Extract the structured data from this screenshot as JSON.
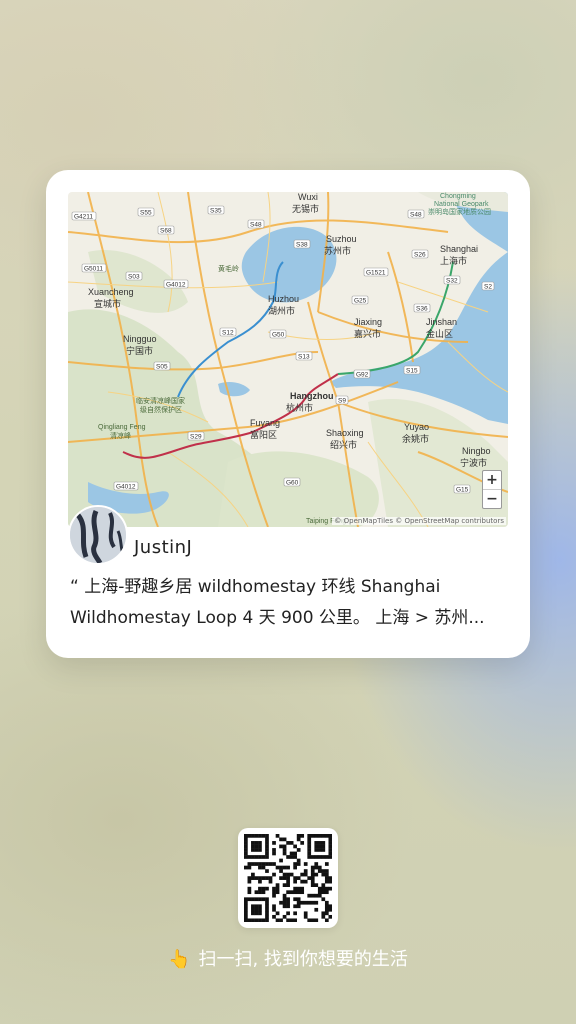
{
  "card": {
    "author": "JustinJ",
    "quote_line1": "“ 上海-野趣乡居 wildhomestay 环线 Shanghai",
    "quote_line2": "Wildhomestay Loop 4 天 900 公里。 上海 > 苏州..."
  },
  "map": {
    "zoom_in": "+",
    "zoom_out": "−",
    "attribution": "© OpenMapTiles © OpenStreetMap contributors",
    "labels": {
      "wuxi": "Wuxi",
      "wuxi_cn": "无锡市",
      "suzhou": "Suzhou",
      "suzhou_cn": "苏州市",
      "shanghai": "Shanghai",
      "shanghai_cn": "上海市",
      "huzhou": "Huzhou",
      "huzhou_cn": "湖州市",
      "jiaxing": "Jiaxing",
      "jiaxing_cn": "嘉兴市",
      "jinshan": "Jinshan",
      "jinshan_cn": "金山区",
      "xuancheng": "Xuancheng",
      "xuancheng_cn": "宣城市",
      "ningguo": "Ningguo",
      "ningguo_cn": "宁国市",
      "hangzhou": "Hangzhou",
      "hangzhou_cn": "杭州市",
      "fuyang": "Fuyang",
      "fuyang_cn": "富阳区",
      "shaoxing": "Shaoxing",
      "shaoxing_cn": "绍兴市",
      "yuyao": "Yuyao",
      "yuyao_cn": "余姚市",
      "ningbo": "Ningbo",
      "ningbo_cn": "宁波市",
      "qingliang": "Qingliang Feng",
      "qingliang_cn": "清凉峰",
      "reserve_1": "临安清凉峰国家",
      "reserve_2": "级自然保护区",
      "mountain": "黄毛岭",
      "chongming_1": "Chongming",
      "chongming_2": "National Geopark",
      "chongming_3": "崇明岛国家地质公园",
      "taiping": "Taiping Feng"
    },
    "shields": [
      "S55",
      "S35",
      "S48",
      "S48",
      "G4211",
      "S68",
      "S38",
      "S26",
      "G5011",
      "S03",
      "G4012",
      "G1521",
      "S32",
      "S2",
      "S36",
      "S12",
      "G50",
      "G25",
      "S13",
      "S05",
      "G92",
      "S15",
      "S9",
      "S29",
      "G60",
      "G4012",
      "G15"
    ]
  },
  "share": {
    "scan_text": "扫一扫, 找到你想要的生活",
    "hand_icon": "👆"
  }
}
